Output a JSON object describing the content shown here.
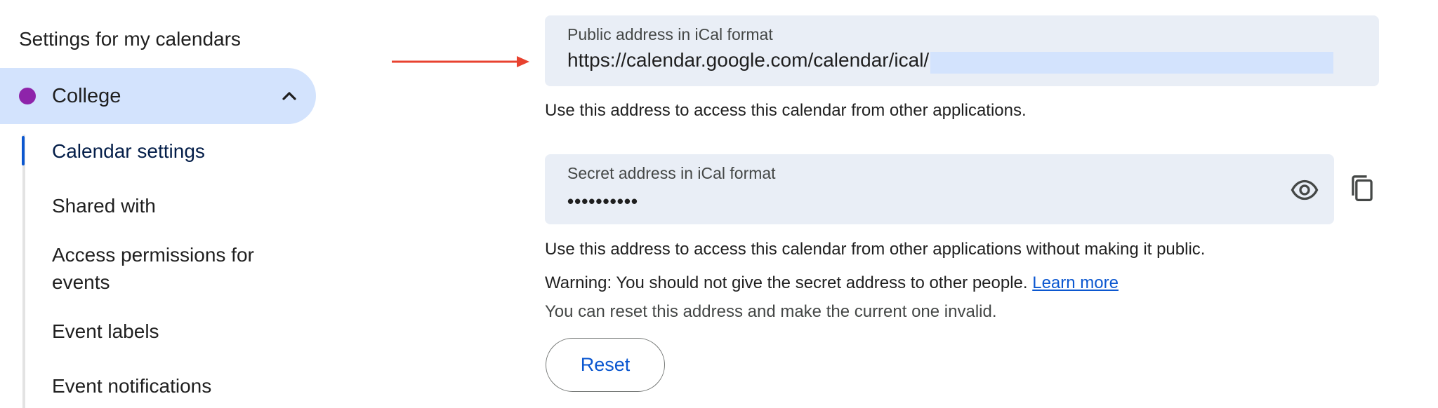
{
  "sidebar": {
    "heading": "Settings for my calendars",
    "calendar": {
      "name": "College",
      "color": "#8e24aa"
    },
    "items": [
      {
        "label": "Calendar settings"
      },
      {
        "label": "Shared with"
      },
      {
        "label": "Access permissions for events"
      },
      {
        "label": "Event labels"
      },
      {
        "label": "Event notifications"
      }
    ]
  },
  "public_address": {
    "label": "Public address in iCal format",
    "value": "https://calendar.google.com/calendar/ical/",
    "help": "Use this address to access this calendar from other applications."
  },
  "secret_address": {
    "label": "Secret address in iCal format",
    "masked_value": "••••••••••",
    "help": "Use this address to access this calendar from other applications without making it public.",
    "warning": "Warning: You should not give the secret address to other people.",
    "learn_more": "Learn more",
    "reset_note": "You can reset this address and make the current one invalid.",
    "reset_label": "Reset"
  },
  "icons": {
    "collapse": "chevron-up-icon",
    "show_secret": "eye-icon",
    "copy": "copy-icon",
    "annotation": "arrow-icon"
  },
  "colors": {
    "accent": "#0b57d0",
    "selected_bg": "#d3e3fd",
    "field_bg": "#e9eef6",
    "annotation_arrow": "#e8422f"
  }
}
